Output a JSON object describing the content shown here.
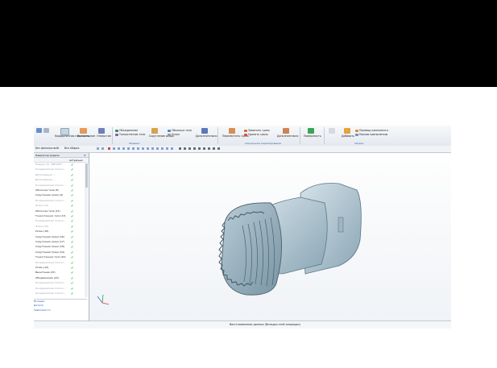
{
  "ribbon": {
    "groups": [
      {
        "name": "part-group",
        "items": [
          "Координатная плоскость",
          "Вытягивание",
          "Отверстие"
        ]
      },
      {
        "name": "elements-group",
        "label": "Элемент",
        "items": [
          "Объединение",
          "Тонкостенное тело",
          "Оболочка тела",
          "Скругление ребра",
          "Уклон",
          "Дополнительно"
        ]
      },
      {
        "name": "sync-group",
        "label": "Синхронное моделирование",
        "items": [
          "Переместить грань",
          "Заменить грань",
          "Удалить грань",
          "Дополнительно"
        ]
      },
      {
        "name": "surface-group",
        "items": [
          "Поверхность"
        ]
      },
      {
        "name": "assembly-group",
        "label": "Сборка",
        "items": [
          "Добавить",
          "Перевод компонента",
          "Массив компонентов"
        ]
      }
    ]
  },
  "toolbar2": {
    "filter_label": "Без фильтра выб.",
    "scope": "Вся сборка"
  },
  "navigator": {
    "title": "Навигатор модели",
    "column_updated": "Актуально",
    "items": [
      {
        "label": "Модель (3) \"ИМПОРТ\"",
        "dim": true
      },
      {
        "label": "Координатная плоско...",
        "dim": true
      },
      {
        "label": "Вытягивание ...",
        "dim": true
      },
      {
        "label": "Вытягивание ...",
        "dim": true
      },
      {
        "label": "Координатная плоско...",
        "dim": true
      },
      {
        "label": "Оболочка тела (8)",
        "dim": false
      },
      {
        "label": "Скругление грани (9)",
        "dim": false
      },
      {
        "label": "Координатная плоско...",
        "dim": true
      },
      {
        "label": "Эскиз (11)",
        "dim": true
      },
      {
        "label": "Оболочка тела (12)",
        "dim": false
      },
      {
        "label": "Тонкостенное тело (13)",
        "dim": false
      },
      {
        "label": "Координатная плоско...",
        "dim": true
      },
      {
        "label": "Эскиз (15)",
        "dim": true
      },
      {
        "label": "Уклон (16)",
        "dim": false
      },
      {
        "label": "Скругление грани (16)",
        "dim": false
      },
      {
        "label": "Скругление грани (17)",
        "dim": false
      },
      {
        "label": "Скругление грани (18)",
        "dim": false
      },
      {
        "label": "Скругление грани (19)",
        "dim": false
      },
      {
        "label": "Тонкостенное тело (20)",
        "dim": false
      },
      {
        "label": "Координатная плоско...",
        "dim": true
      },
      {
        "label": "Уклон (22)",
        "dim": false
      },
      {
        "label": "Вычитание (23)",
        "dim": false
      },
      {
        "label": "Объединение (24)",
        "dim": false
      },
      {
        "label": "Координатная плоско...",
        "dim": true
      },
      {
        "label": "Координатная плоско...",
        "dim": true
      },
      {
        "label": "Координатная плоско...",
        "dim": true
      }
    ],
    "sections": [
      "Вкладки",
      "Детали",
      "Зависимости"
    ]
  },
  "status": "Восстановление данных (Вкладка этой операции)"
}
